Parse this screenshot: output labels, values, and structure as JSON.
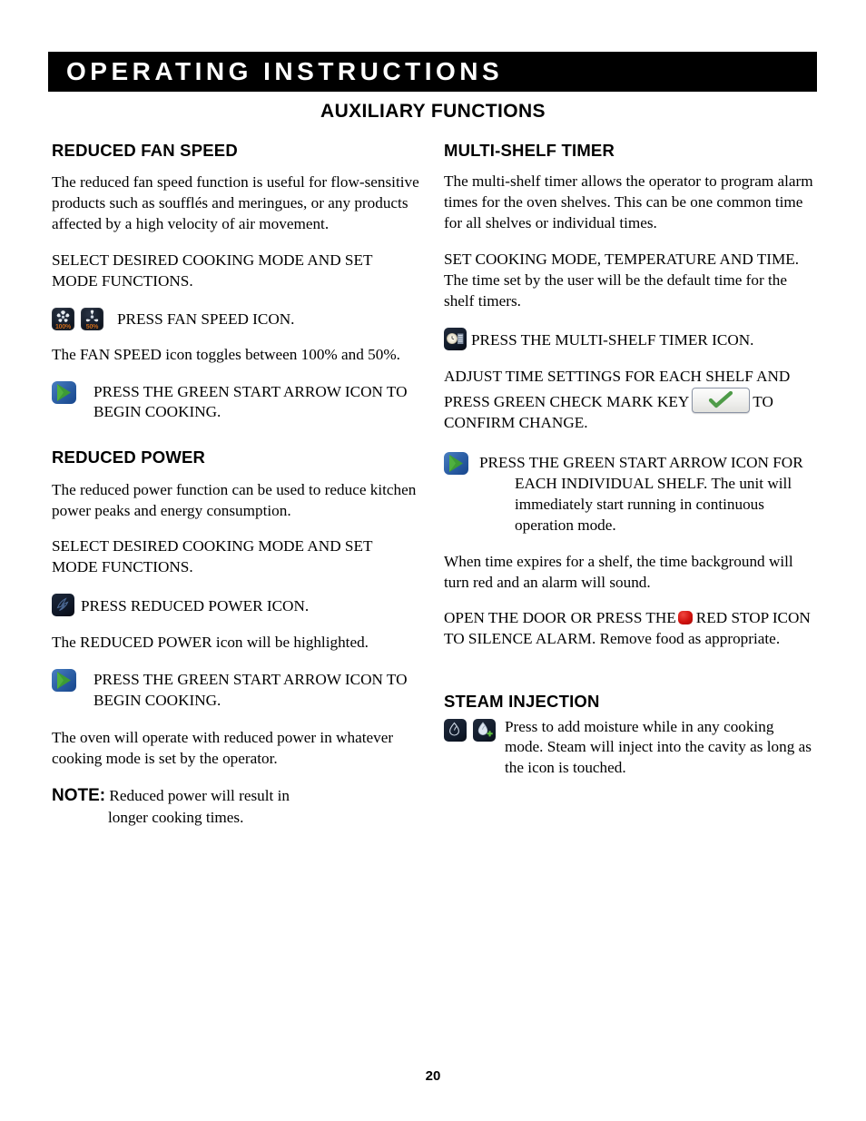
{
  "header": {
    "banner_title": "OPERATING INSTRUCTIONS",
    "page_subtitle": "AUXILIARY FUNCTIONS"
  },
  "colors": {
    "banner_background": "#000000",
    "banner_text": "#ffffff",
    "start_icon_background": "#2f62a8",
    "start_icon_arrow": "#3d9b35",
    "stop_icon": "#d1120e",
    "check_mark": "#4e9b48",
    "fan_percent_text": "#c8691a",
    "icon_dark_background": "#101a2a"
  },
  "left_column": {
    "sections": [
      {
        "heading": "REDUCED FAN SPEED",
        "intro": "The reduced fan speed function is useful for flow-sensitive products such as soufflés and meringues, or any products affected by a high velocity of air movement.",
        "step_caps": "SELECT DESIRED COOKING MODE AND SET MODE FUNCTIONS.",
        "fan_icons": [
          {
            "name": "fan-speed-100-icon",
            "label": "100%"
          },
          {
            "name": "fan-speed-50-icon",
            "label": "50%"
          }
        ],
        "fan_press_text": "PRESS FAN SPEED ICON.",
        "toggle_text": "The FAN SPEED icon toggles between 100% and 50%.",
        "start_text": "PRESS THE GREEN START ARROW ICON TO BEGIN COOKING."
      },
      {
        "heading": "REDUCED POWER",
        "intro": "The reduced power function can be used to reduce kitchen power peaks and energy consumption.",
        "step_caps": "SELECT DESIRED COOKING MODE AND SET MODE FUNCTIONS.",
        "power_press_text": "PRESS REDUCED POWER ICON.",
        "highlight_text": "The REDUCED POWER icon will be highlighted.",
        "start_text": "PRESS THE GREEN START ARROW ICON TO BEGIN COOKING.",
        "operate_text": "The oven will operate with reduced power in whatever cooking mode is set by the operator.",
        "note_label": "NOTE:",
        "note_line1": "Reduced power will result in",
        "note_line2": "longer cooking times."
      }
    ]
  },
  "right_column": {
    "sections": [
      {
        "heading": "MULTI-SHELF TIMER",
        "intro": "The multi-shelf timer allows the operator to program alarm times for the oven shelves. This can be one common time for all shelves or individual times.",
        "step_caps": "SET COOKING MODE, TEMPERATURE AND TIME. The time set by the user will be the default time for the shelf timers.",
        "timer_press_text": "PRESS THE MULTI-SHELF TIMER ICON.",
        "adjust_text_before": "ADJUST TIME SETTINGS FOR EACH SHELF AND PRESS GREEN CHECK MARK KEY",
        "adjust_text_after": "TO CONFIRM CHANGE.",
        "start_text": "PRESS THE GREEN START ARROW ICON FOR EACH INDIVIDUAL SHELF. The unit will immediately start running in continuous operation mode.",
        "expire_text": "When time expires for a shelf, the time background will turn red and an alarm will sound.",
        "silence_before": "OPEN THE DOOR OR PRESS THE",
        "silence_after": "RED STOP ICON TO SILENCE ALARM. Remove food as appropriate."
      },
      {
        "heading": "STEAM INJECTION",
        "steam_icons": [
          {
            "name": "steam-drop-icon"
          },
          {
            "name": "steam-add-icon"
          }
        ],
        "body": "Press to add moisture while in any cooking mode. Steam will inject into the cavity as long as the icon is touched."
      }
    ]
  },
  "footer": {
    "page_number": "20"
  }
}
